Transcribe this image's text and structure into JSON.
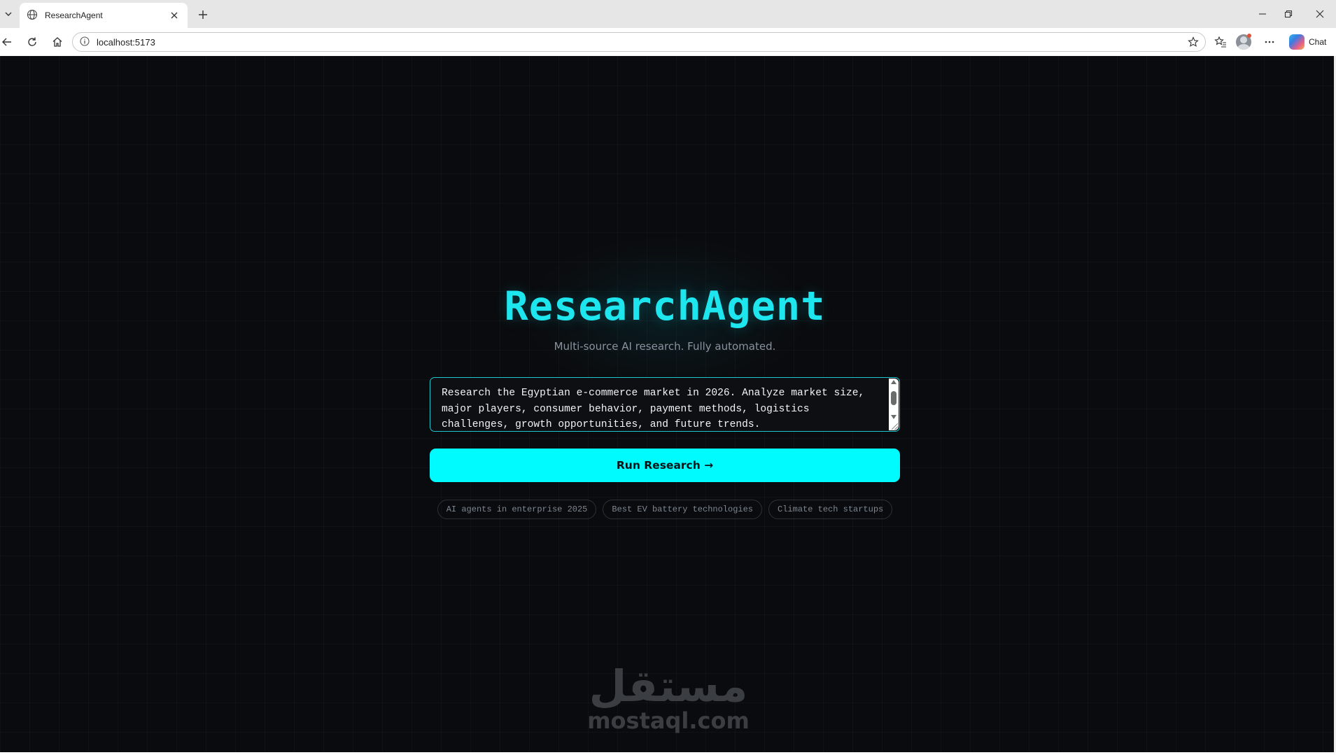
{
  "browser": {
    "tab_title": "ResearchAgent",
    "url": "localhost:5173",
    "chat_label": "Chat"
  },
  "app": {
    "title": "ResearchAgent",
    "subtitle": "Multi-source AI research. Fully automated.",
    "prompt_value": "Research the Egyptian e-commerce market in 2026. Analyze market size, major players, consumer behavior, payment methods, logistics challenges, growth opportunities, and future trends.",
    "run_button_label": "Run Research →",
    "suggestions": [
      "AI agents in enterprise 2025",
      "Best EV battery technologies",
      "Climate tech startups"
    ],
    "accent_color": "#00fbff"
  },
  "watermark": {
    "arabic": "مستقل",
    "latin": "mostaql.com"
  }
}
